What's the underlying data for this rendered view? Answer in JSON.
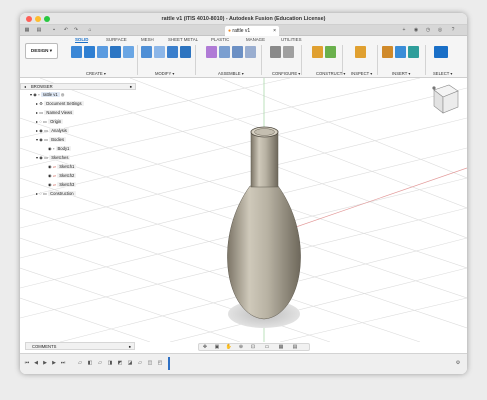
{
  "window": {
    "title": "rattle v1 (ITIS 4010-8010) - Autodesk Fusion (Education License)"
  },
  "tab": {
    "name": "rattle v1"
  },
  "workspace": {
    "label": "DESIGN ▾"
  },
  "ribbon": {
    "tabs": [
      "SOLID",
      "SURFACE",
      "MESH",
      "SHEET METAL",
      "PLASTIC",
      "MANAGE",
      "UTILITIES"
    ],
    "groups": [
      "CREATE ▾",
      "MODIFY ▾",
      "ASSEMBLE ▾",
      "CONFIGURE ▾",
      "CONSTRUCT ▾",
      "INSPECT ▾",
      "INSERT ▾",
      "SELECT ▾"
    ]
  },
  "browser": {
    "title": "BROWSER",
    "root": "rattle v1",
    "items": [
      "Document Settings",
      "Named Views",
      "Origin",
      "Analysis",
      "Bodies",
      "Body1",
      "Sketches",
      "Sketch1",
      "Sketch2",
      "Sketch3",
      "Construction"
    ]
  },
  "comments": {
    "label": "COMMENTS"
  },
  "colors": {
    "accent": "#1a6fc7",
    "body": "#b9b3a5",
    "grid": "#dcdcdc"
  }
}
